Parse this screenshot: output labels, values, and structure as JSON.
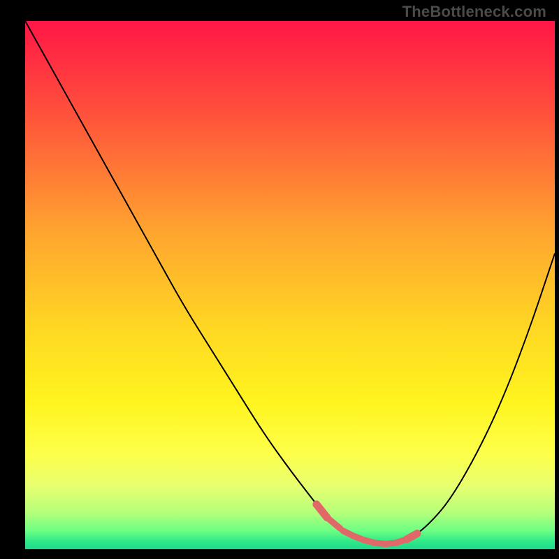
{
  "watermark": "TheBottleneck.com",
  "colors": {
    "frame_bg": "#000000",
    "watermark": "#4b4b4b",
    "curve_stroke": "#000000",
    "marker_fill": "#e06868",
    "gradient_stops": [
      {
        "offset": 0.0,
        "color": "#ff1646"
      },
      {
        "offset": 0.2,
        "color": "#ff5a3a"
      },
      {
        "offset": 0.4,
        "color": "#ffa52f"
      },
      {
        "offset": 0.58,
        "color": "#ffd723"
      },
      {
        "offset": 0.72,
        "color": "#fff41e"
      },
      {
        "offset": 0.82,
        "color": "#fdff4a"
      },
      {
        "offset": 0.88,
        "color": "#e8ff70"
      },
      {
        "offset": 0.93,
        "color": "#b6ff7a"
      },
      {
        "offset": 0.965,
        "color": "#6dff84"
      },
      {
        "offset": 0.985,
        "color": "#2fe989"
      },
      {
        "offset": 1.0,
        "color": "#1fd98a"
      }
    ]
  },
  "chart_data": {
    "type": "line",
    "title": "",
    "xlabel": "",
    "ylabel": "",
    "xlim": [
      0,
      100
    ],
    "ylim": [
      0,
      100
    ],
    "grid": false,
    "series": [
      {
        "name": "curve",
        "x": [
          0,
          5,
          10,
          15,
          20,
          25,
          30,
          35,
          40,
          45,
          50,
          55,
          57,
          60,
          63,
          66,
          68,
          70,
          73,
          76,
          80,
          85,
          90,
          95,
          100
        ],
        "values": [
          100,
          91,
          82,
          73,
          64,
          55,
          46,
          38,
          30,
          22,
          15,
          8.5,
          6,
          3.5,
          2,
          1.2,
          1,
          1.2,
          2.2,
          4.5,
          9,
          17.5,
          28,
          41,
          56
        ]
      }
    ],
    "annotations": {
      "bottom_markers_x": [
        56.0,
        58.5,
        61.0,
        63.0,
        65.0,
        67.0,
        69.0,
        71.0,
        73.0
      ]
    }
  }
}
